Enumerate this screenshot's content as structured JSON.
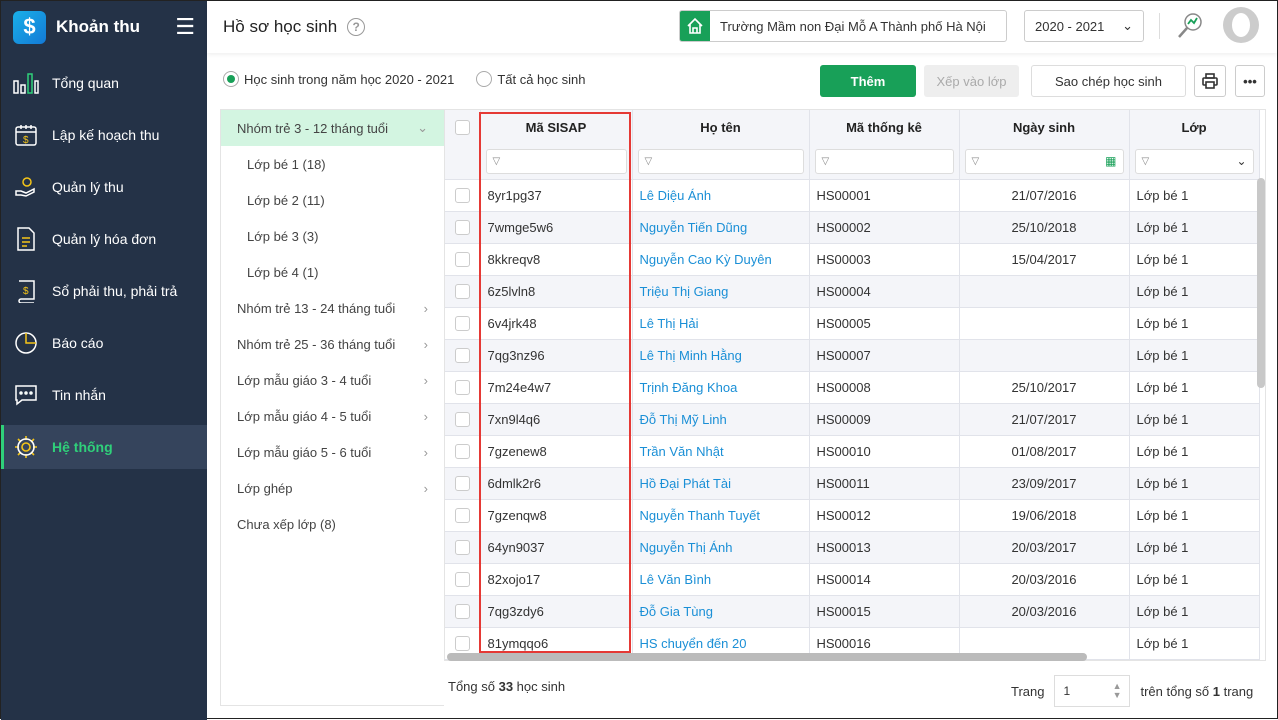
{
  "app": {
    "name": "Khoản thu",
    "logo_glyph": "$"
  },
  "sidebar": {
    "items": [
      {
        "label": "Tổng quan",
        "icon": "bar-chart-icon"
      },
      {
        "label": "Lập kế hoạch thu",
        "icon": "calendar-dollar-icon"
      },
      {
        "label": "Quản lý thu",
        "icon": "hand-coin-icon"
      },
      {
        "label": "Quản lý hóa đơn",
        "icon": "invoice-icon"
      },
      {
        "label": "Sổ phải thu, phải trả",
        "icon": "ledger-book-icon"
      },
      {
        "label": "Báo cáo",
        "icon": "pie-chart-icon"
      },
      {
        "label": "Tin nhắn",
        "icon": "chat-icon"
      },
      {
        "label": "Hệ thống",
        "icon": "gear-icon",
        "active": true
      }
    ]
  },
  "header": {
    "title": "Hồ sơ học sinh",
    "help": "?",
    "school": "Trường Mầm non Đại Mỗ A Thành phố Hà Nội",
    "year": "2020 - 2021"
  },
  "filters": {
    "current_year": "Học sinh trong năm học 2020 - 2021",
    "all": "Tất cả học sinh",
    "selected": "current_year"
  },
  "toolbar": {
    "add": "Thêm",
    "assign": "Xếp vào lớp",
    "copy": "Sao chép học sinh"
  },
  "colors": {
    "accent": "#18a058",
    "sidebar": "#243247",
    "link": "#1a8fd6",
    "highlight": "#e53935"
  },
  "tree": [
    {
      "label": "Nhóm trẻ 3 - 12 tháng tuổi",
      "expanded": true,
      "children": [
        "Lớp bé 1 (18)",
        "Lớp bé 2 (11)",
        "Lớp bé 3 (3)",
        "Lớp bé 4 (1)"
      ]
    },
    {
      "label": "Nhóm trẻ 13 - 24 tháng tuổi"
    },
    {
      "label": "Nhóm trẻ 25 - 36 tháng tuổi"
    },
    {
      "label": "Lớp mẫu giáo 3 - 4 tuổi"
    },
    {
      "label": "Lớp mẫu giáo 4 - 5 tuổi"
    },
    {
      "label": "Lớp mẫu giáo 5 - 6 tuổi"
    },
    {
      "label": "Lớp ghép"
    },
    {
      "label": "Chưa xếp lớp (8)",
      "leaf": true
    }
  ],
  "table": {
    "columns": [
      "Mã SISAP",
      "Họ tên",
      "Mã thống kê",
      "Ngày sinh",
      "Lớp"
    ],
    "rows": [
      [
        "8yr1pg37",
        "Lê Diệu Ánh",
        "HS00001",
        "21/07/2016",
        "Lớp bé 1"
      ],
      [
        "7wmge5w6",
        "Nguyễn Tiến Dũng",
        "HS00002",
        "25/10/2018",
        "Lớp bé 1"
      ],
      [
        "8kkreqv8",
        "Nguyễn Cao Kỳ Duyên",
        "HS00003",
        "15/04/2017",
        "Lớp bé 1"
      ],
      [
        "6z5lvln8",
        "Triệu Thị Giang",
        "HS00004",
        "",
        "Lớp bé 1"
      ],
      [
        "6v4jrk48",
        "Lê Thị Hải",
        "HS00005",
        "",
        "Lớp bé 1"
      ],
      [
        "7qg3nz96",
        "Lê Thị Minh Hằng",
        "HS00007",
        "",
        "Lớp bé 1"
      ],
      [
        "7m24e4w7",
        "Trịnh Đăng Khoa",
        "HS00008",
        "25/10/2017",
        "Lớp bé 1"
      ],
      [
        "7xn9l4q6",
        "Đỗ Thị Mỹ Linh",
        "HS00009",
        "21/07/2017",
        "Lớp bé 1"
      ],
      [
        "7gzenew8",
        "Trần Văn Nhật",
        "HS00010",
        "01/08/2017",
        "Lớp bé 1"
      ],
      [
        "6dmlk2r6",
        "Hồ Đại Phát Tài",
        "HS00011",
        "23/09/2017",
        "Lớp bé 1"
      ],
      [
        "7gzenqw8",
        "Nguyễn Thanh Tuyết",
        "HS00012",
        "19/06/2018",
        "Lớp bé 1"
      ],
      [
        "64yn9037",
        "Nguyễn Thị Ánh",
        "HS00013",
        "20/03/2017",
        "Lớp bé 1"
      ],
      [
        "82xojo17",
        "Lê Văn Bình",
        "HS00014",
        "20/03/2016",
        "Lớp bé 1"
      ],
      [
        "7qg3zdy6",
        "Đỗ Gia Tùng",
        "HS00015",
        "20/03/2016",
        "Lớp bé 1"
      ],
      [
        "81ymqqo6",
        "HS chuyển đến 20",
        "HS00016",
        "",
        "Lớp bé 1"
      ]
    ]
  },
  "footer": {
    "total_prefix": "Tổng số ",
    "total": "33",
    "total_suffix": " học sinh",
    "page_label": "Trang",
    "page": "1",
    "of_prefix": "trên tổng số ",
    "pages": "1",
    "of_suffix": " trang"
  }
}
